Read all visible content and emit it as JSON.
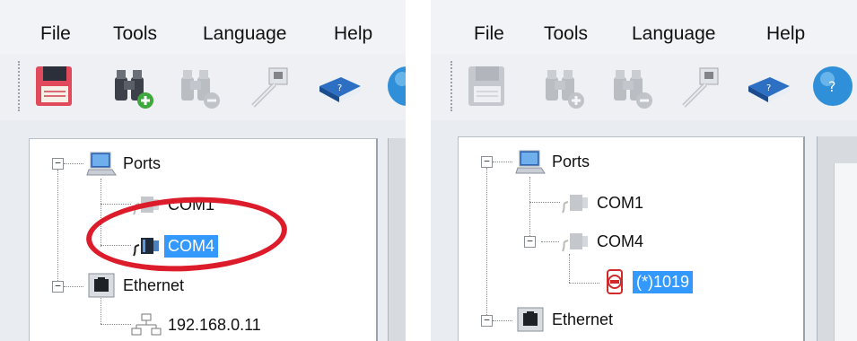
{
  "left": {
    "menu": [
      "File",
      "Tools",
      "Language",
      "Help"
    ],
    "toolbar": [
      {
        "icon": "save-icon",
        "enabled": true
      },
      {
        "icon": "binoculars-add-icon",
        "enabled": true
      },
      {
        "icon": "binoculars-remove-icon",
        "enabled": false
      },
      {
        "icon": "network-cable-icon",
        "enabled": false
      },
      {
        "icon": "help-book-icon",
        "enabled": true
      },
      {
        "icon": "help-globe-icon",
        "enabled": true
      }
    ],
    "tree": {
      "ports_label": "Ports",
      "com1_label": "COM1",
      "com4_label": "COM4",
      "ethernet_label": "Ethernet",
      "ip_label": "192.168.0.11"
    }
  },
  "right": {
    "menu": [
      "File",
      "Tools",
      "Language",
      "Help"
    ],
    "toolbar": [
      {
        "icon": "save-icon",
        "enabled": false
      },
      {
        "icon": "binoculars-add-icon",
        "enabled": false
      },
      {
        "icon": "binoculars-remove-icon",
        "enabled": false
      },
      {
        "icon": "network-cable-icon",
        "enabled": false
      },
      {
        "icon": "help-book-icon",
        "enabled": true
      },
      {
        "icon": "help-globe-icon",
        "enabled": true
      }
    ],
    "tree": {
      "ports_label": "Ports",
      "com1_label": "COM1",
      "com4_label": "COM4",
      "device_label": "(*)1019",
      "ethernet_label": "Ethernet"
    }
  },
  "colors": {
    "selection": "#3399ff",
    "annotation_ring": "#dd1c2b"
  }
}
